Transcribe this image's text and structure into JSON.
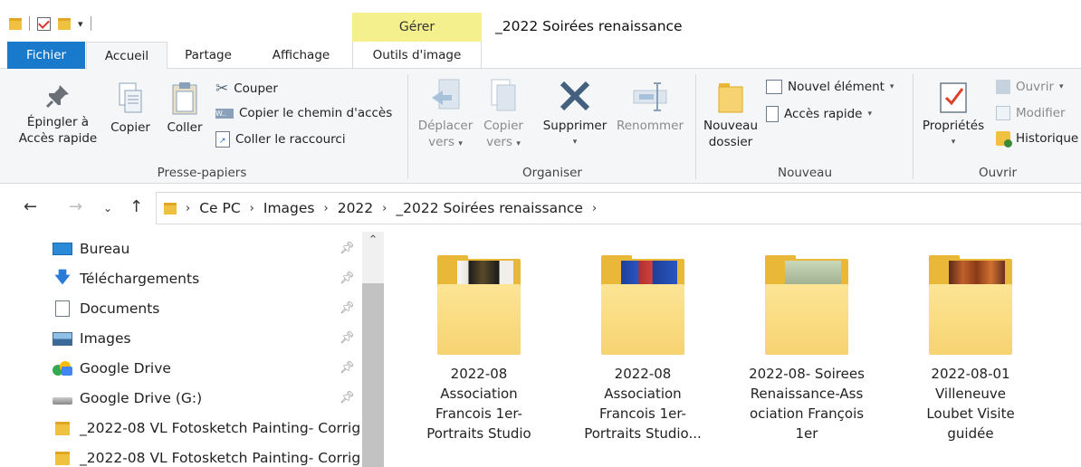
{
  "window": {
    "title": "_2022 Soirées renaissance",
    "contextual_tab_header": "Gérer"
  },
  "ribbon_tabs": {
    "fichier": "Fichier",
    "accueil": "Accueil",
    "partage": "Partage",
    "affichage": "Affichage",
    "outils": "Outils d'image"
  },
  "ribbon": {
    "clipboard": {
      "label": "Presse-papiers",
      "pin_line1": "Épingler à",
      "pin_line2": "Accès rapide",
      "copy": "Copier",
      "paste": "Coller",
      "cut": "Couper",
      "copy_path": "Copier le chemin d'accès",
      "paste_shortcut": "Coller le raccourci"
    },
    "organize": {
      "label": "Organiser",
      "move_line1": "Déplacer",
      "move_line2": "vers",
      "copyto_line1": "Copier",
      "copyto_line2": "vers",
      "delete": "Supprimer",
      "rename": "Renommer"
    },
    "new": {
      "label": "Nouveau",
      "new_folder_line1": "Nouveau",
      "new_folder_line2": "dossier",
      "new_item": "Nouvel élément",
      "quick_access": "Accès rapide"
    },
    "open": {
      "label": "Ouvrir",
      "properties": "Propriétés",
      "open": "Ouvrir",
      "edit": "Modifier",
      "history": "Historique"
    }
  },
  "breadcrumb": [
    "Ce PC",
    "Images",
    "2022",
    "_2022 Soirées renaissance"
  ],
  "nav_pane": [
    {
      "label": "Bureau",
      "icon": "desktop-icon",
      "pinned": true
    },
    {
      "label": "Téléchargements",
      "icon": "download-icon",
      "pinned": true
    },
    {
      "label": "Documents",
      "icon": "documents-icon",
      "pinned": true
    },
    {
      "label": "Images",
      "icon": "pictures-icon",
      "pinned": true
    },
    {
      "label": "Google Drive",
      "icon": "google-drive-icon",
      "pinned": true
    },
    {
      "label": "Google Drive (G:)",
      "icon": "drive-icon",
      "pinned": true
    },
    {
      "label": "_2022-08 VL Fotosketch Painting- Corrig",
      "icon": "folder-icon",
      "pinned": false
    },
    {
      "label": "_2022-08 VL Fotosketch Painting- Corrig",
      "icon": "folder-icon",
      "pinned": false
    }
  ],
  "folders": [
    {
      "lines": [
        "2022-08",
        "Association",
        "Francois 1er-",
        "Portraits Studio"
      ],
      "accent": "#6b4f2a"
    },
    {
      "lines": [
        "2022-08",
        "Association",
        "Francois 1er-",
        "Portraits Studio..."
      ],
      "accent": "#2a4fa8"
    },
    {
      "lines": [
        "2022-08- Soirees",
        "Renaissance-Ass",
        "ociation François",
        "1er"
      ],
      "accent": "#8a8f6a"
    },
    {
      "lines": [
        "2022-08-01",
        "Villeneuve",
        "Loubet Visite",
        "guidée"
      ],
      "accent": "#b0582a"
    }
  ]
}
